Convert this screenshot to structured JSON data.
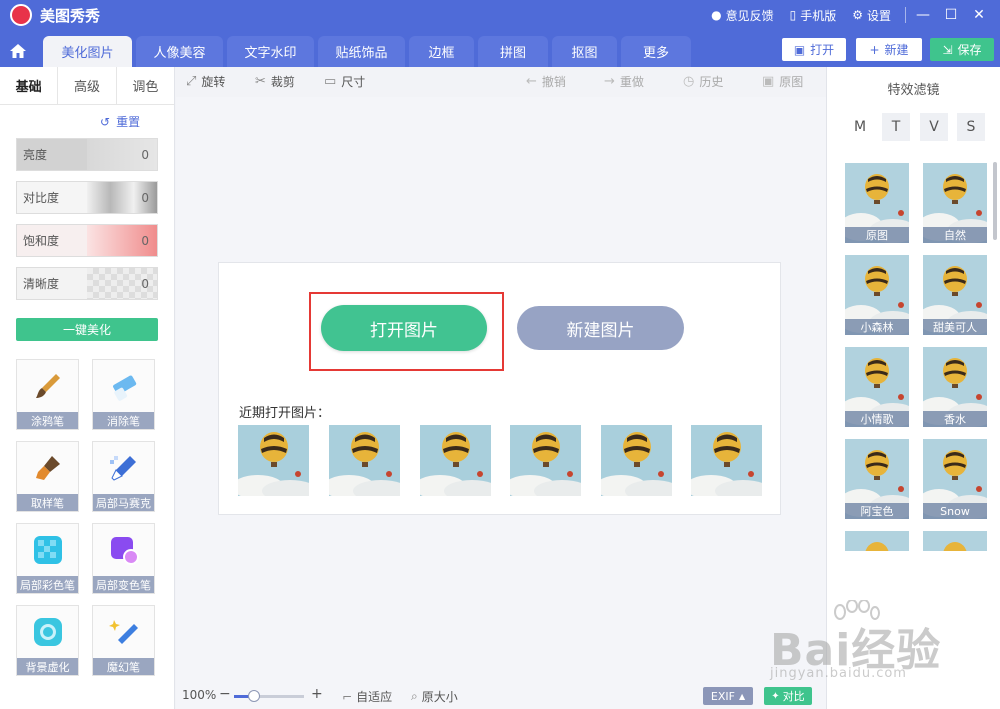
{
  "app": {
    "title": "美图秀秀",
    "logo_text": "meitu"
  },
  "titlebar": {
    "feedback": "意见反馈",
    "mobile": "手机版",
    "settings": "设置"
  },
  "tabs": [
    {
      "label": "美化图片"
    },
    {
      "label": "人像美容"
    },
    {
      "label": "文字水印"
    },
    {
      "label": "贴纸饰品"
    },
    {
      "label": "边框"
    },
    {
      "label": "拼图"
    },
    {
      "label": "抠图"
    },
    {
      "label": "更多"
    }
  ],
  "actions": {
    "open": "打开",
    "new": "新建",
    "save": "保存"
  },
  "left": {
    "subtabs": [
      "基础",
      "高级",
      "调色"
    ],
    "reset": "重置",
    "sliders": [
      {
        "label": "亮度",
        "value": "0"
      },
      {
        "label": "对比度",
        "value": "0"
      },
      {
        "label": "饱和度",
        "value": "0"
      },
      {
        "label": "清晰度",
        "value": "0"
      }
    ],
    "one_click": "一键美化",
    "tools": [
      "涂鸦笔",
      "消除笔",
      "取样笔",
      "局部马赛克",
      "局部彩色笔",
      "局部变色笔",
      "背景虚化",
      "魔幻笔"
    ]
  },
  "toolbar": {
    "rotate": "旋转",
    "crop": "裁剪",
    "size": "尺寸",
    "undo": "撤销",
    "redo": "重做",
    "history": "历史",
    "original": "原图"
  },
  "canvas": {
    "open_image": "打开图片",
    "new_image": "新建图片",
    "recent_title": "近期打开图片："
  },
  "bottom": {
    "zoom": "100%",
    "zoom_level": 0.28,
    "fit": "自适应",
    "original_size": "原大小",
    "exif": "EXIF",
    "compare": "对比"
  },
  "right": {
    "title": "特效滤镜",
    "letters": [
      "M",
      "T",
      "V",
      "S"
    ],
    "filters": [
      "原图",
      "自然",
      "小森林",
      "甜美可人",
      "小情歌",
      "香水",
      "阿宝色",
      "Snow"
    ]
  },
  "watermark": {
    "main": "Bai经验",
    "sub": "jingyan.baidu.com"
  },
  "colors": {
    "brand": "#4f6bd8",
    "green": "#41c391",
    "red": "#e53935",
    "gray_button": "#97a3c4"
  }
}
